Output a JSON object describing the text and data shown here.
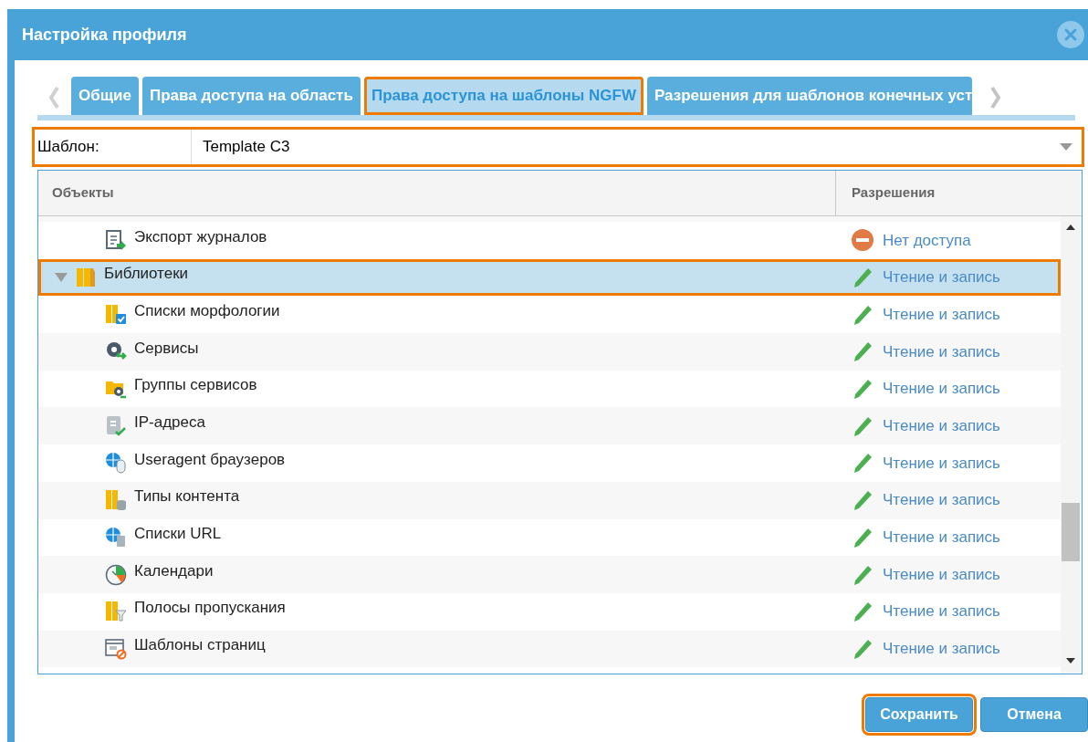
{
  "window": {
    "title": "Настройка профиля"
  },
  "tabs": [
    {
      "label": "Общие",
      "selected": false,
      "highlighted": false
    },
    {
      "label": "Права доступа на область",
      "selected": false,
      "highlighted": false
    },
    {
      "label": "Права доступа на шаблоны NGFW",
      "selected": true,
      "highlighted": true
    },
    {
      "label": "Разрешения для шаблонов конечных уст",
      "selected": false,
      "highlighted": false
    }
  ],
  "template": {
    "label": "Шаблон:",
    "value": "Template C3",
    "highlighted": true
  },
  "table": {
    "columns": [
      "Объекты",
      "Разрешения"
    ],
    "rows": [
      {
        "label": "Экспорт журналов",
        "selected": false,
        "highlighted": false,
        "permission": {
          "kind": "no_access",
          "label": "Нет доступа"
        }
      },
      {
        "label": "Библиотеки",
        "expanded": true,
        "selected": true,
        "highlighted": true,
        "permission": {
          "kind": "read_write",
          "label": "Чтение и запись"
        },
        "children": [
          {
            "label": "Списки морфологии",
            "selected": false,
            "highlighted": false,
            "permission": {
              "kind": "read_write",
              "label": "Чтение и запись"
            }
          },
          {
            "label": "Сервисы",
            "selected": false,
            "highlighted": false,
            "permission": {
              "kind": "read_write",
              "label": "Чтение и запись"
            }
          },
          {
            "label": "Группы сервисов",
            "selected": false,
            "highlighted": false,
            "permission": {
              "kind": "read_write",
              "label": "Чтение и запись"
            }
          },
          {
            "label": "IP-адреса",
            "selected": false,
            "highlighted": false,
            "permission": {
              "kind": "read_write",
              "label": "Чтение и запись"
            }
          },
          {
            "label": "Useragent браузеров",
            "selected": false,
            "highlighted": false,
            "permission": {
              "kind": "read_write",
              "label": "Чтение и запись"
            }
          },
          {
            "label": "Типы контента",
            "selected": false,
            "highlighted": false,
            "permission": {
              "kind": "read_write",
              "label": "Чтение и запись"
            }
          },
          {
            "label": "Списки URL",
            "selected": false,
            "highlighted": false,
            "permission": {
              "kind": "read_write",
              "label": "Чтение и запись"
            }
          },
          {
            "label": "Календари",
            "selected": false,
            "highlighted": false,
            "permission": {
              "kind": "read_write",
              "label": "Чтение и запись"
            }
          },
          {
            "label": "Полосы пропускания",
            "selected": false,
            "highlighted": false,
            "permission": {
              "kind": "read_write",
              "label": "Чтение и запись"
            }
          },
          {
            "label": "Шаблоны страниц",
            "selected": false,
            "highlighted": false,
            "permission": {
              "kind": "read_write",
              "label": "Чтение и запись"
            }
          }
        ]
      }
    ]
  },
  "buttons": [
    {
      "label": "Сохранить",
      "highlighted": true
    },
    {
      "label": "Отмена",
      "highlighted": false
    }
  ]
}
